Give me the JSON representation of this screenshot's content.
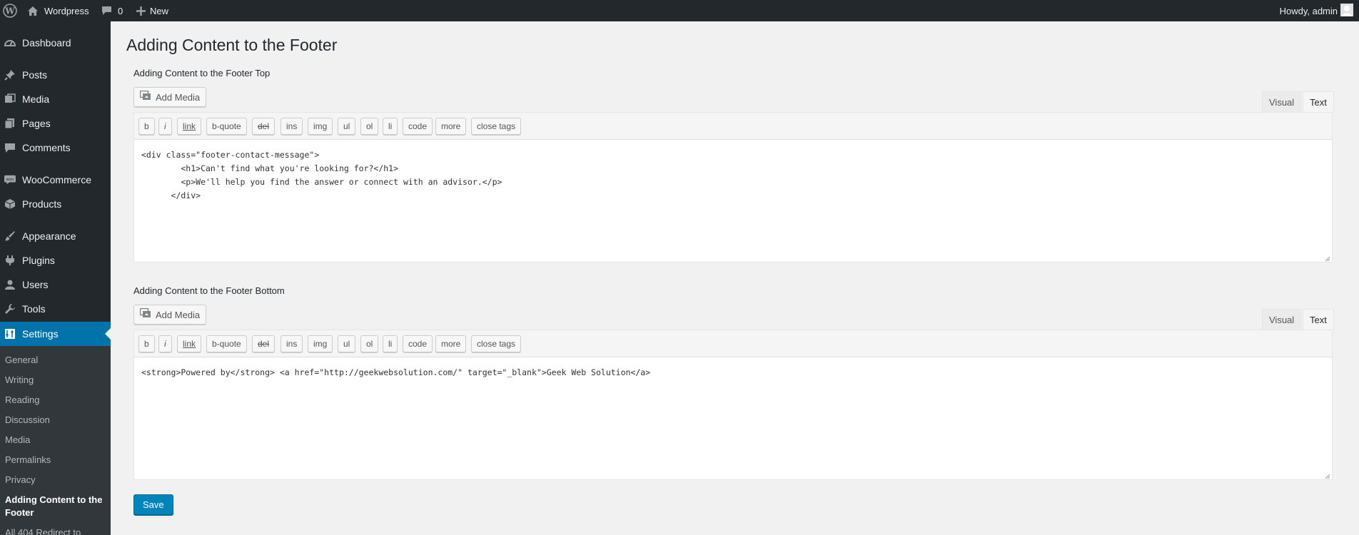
{
  "adminbar": {
    "site_name": "Wordpress",
    "comment_count": "0",
    "new_label": "New",
    "howdy": "Howdy, admin"
  },
  "sidebar": {
    "items": [
      {
        "label": "Dashboard",
        "icon": "dashboard-icon"
      },
      {
        "label": "Posts",
        "icon": "pin-icon"
      },
      {
        "label": "Media",
        "icon": "media-icon"
      },
      {
        "label": "Pages",
        "icon": "pages-icon"
      },
      {
        "label": "Comments",
        "icon": "comment-icon"
      },
      {
        "label": "WooCommerce",
        "icon": "woocommerce-icon"
      },
      {
        "label": "Products",
        "icon": "products-icon"
      },
      {
        "label": "Appearance",
        "icon": "brush-icon"
      },
      {
        "label": "Plugins",
        "icon": "plugin-icon"
      },
      {
        "label": "Users",
        "icon": "users-icon"
      },
      {
        "label": "Tools",
        "icon": "wrench-icon"
      },
      {
        "label": "Settings",
        "icon": "settings-icon"
      }
    ],
    "submenu": [
      "General",
      "Writing",
      "Reading",
      "Discussion",
      "Media",
      "Permalinks",
      "Privacy",
      "Adding Content to the Footer",
      "All 404 Redirect to"
    ]
  },
  "main": {
    "title": "Adding Content to the Footer",
    "save_label": "Save",
    "editors": [
      {
        "label": "Adding Content to the Footer Top",
        "add_media": "Add Media",
        "tab_visual": "Visual",
        "tab_text": "Text",
        "content": "<div class=\"footer-contact-message\">\n        <h1>Can't find what you're looking for?</h1>\n        <p>We'll help you find the answer or connect with an advisor.</p>\n      </div>"
      },
      {
        "label": "Adding Content to the Footer Bottom",
        "add_media": "Add Media",
        "tab_visual": "Visual",
        "tab_text": "Text",
        "content": "<strong>Powered by</strong> <a href=\"http://geekwebsolution.com/\" target=\"_blank\">Geek Web Solution</a>"
      }
    ],
    "quicktags": [
      "b",
      "i",
      "link",
      "b-quote",
      "del",
      "ins",
      "img",
      "ul",
      "ol",
      "li",
      "code",
      "more",
      "close tags"
    ]
  },
  "colors": {
    "adminbar_bg": "#23282d",
    "sidebar_bg": "#23282d",
    "submenu_bg": "#32373c",
    "accent": "#0073aa",
    "primary_button": "#0085ba"
  }
}
